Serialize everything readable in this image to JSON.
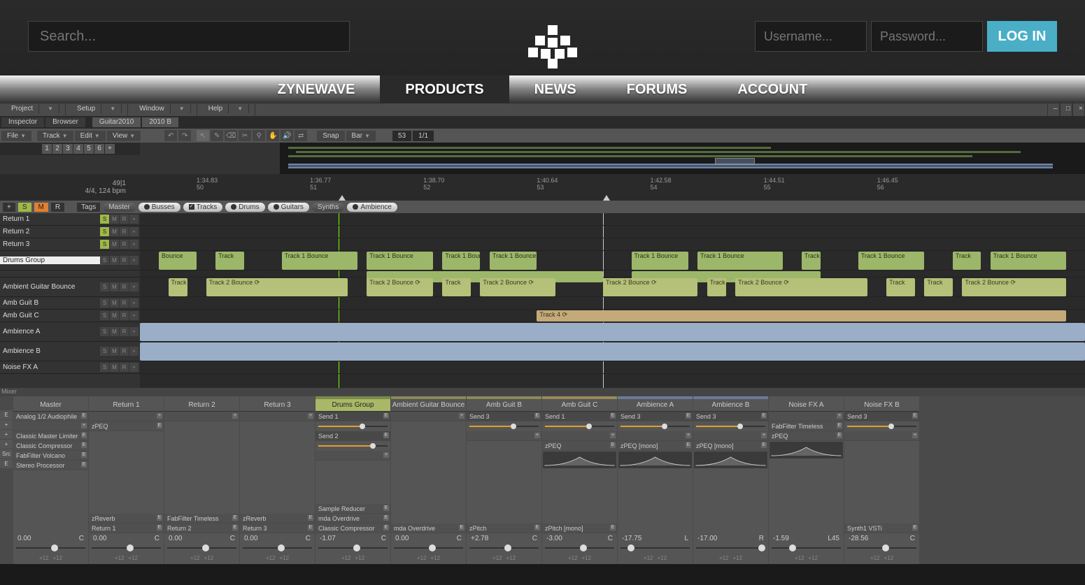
{
  "header": {
    "search_placeholder": "Search...",
    "username_placeholder": "Username...",
    "password_placeholder": "Password...",
    "login": "LOG IN"
  },
  "nav": [
    "ZYNEWAVE",
    "PRODUCTS",
    "NEWS",
    "FORUMS",
    "ACCOUNT"
  ],
  "nav_active": 1,
  "daw": {
    "menus": [
      "Project",
      "Setup",
      "Window",
      "Help"
    ],
    "tabs": [
      "Inspector",
      "Browser",
      "Guitar2010",
      "2010 B"
    ],
    "toolbar": {
      "file": "File",
      "track": "Track",
      "edit": "Edit",
      "view": "View",
      "snap": "Snap",
      "bar": "Bar",
      "pos": "53",
      "sig": "1/1"
    },
    "pages": [
      "1",
      "2",
      "3",
      "4",
      "5",
      "6",
      "+"
    ],
    "ruler": {
      "info_line1": "49|1",
      "info_line2": "4/4, 124 bpm",
      "ticks": [
        {
          "t": "1:34.83",
          "n": "50",
          "x": 6
        },
        {
          "t": "1:36.77",
          "n": "51",
          "x": 18
        },
        {
          "t": "1:38.70",
          "n": "52",
          "x": 30
        },
        {
          "t": "1:40.64",
          "n": "53",
          "x": 42
        },
        {
          "t": "1:42.58",
          "n": "54",
          "x": 54
        },
        {
          "t": "1:44.51",
          "n": "55",
          "x": 66
        },
        {
          "t": "1:46.45",
          "n": "56",
          "x": 78
        }
      ]
    },
    "filters": {
      "tags": "Tags",
      "master": "Master",
      "pills": [
        {
          "label": "Busses",
          "kind": "dot",
          "dark": false
        },
        {
          "label": "Tracks",
          "kind": "chk",
          "dark": false
        },
        {
          "label": "Drums",
          "kind": "dot",
          "dark": false
        },
        {
          "label": "Guitars",
          "kind": "dot",
          "dark": false
        },
        {
          "label": "Synths",
          "kind": "none",
          "dark": true
        },
        {
          "label": "Ambience",
          "kind": "dot",
          "dark": false
        }
      ]
    },
    "tracks": [
      {
        "name": "Return 1",
        "solo": true,
        "grp": false,
        "sel": false,
        "color": "d"
      },
      {
        "name": "Return 2",
        "solo": true,
        "grp": false,
        "sel": false,
        "color": "d"
      },
      {
        "name": "Return 3",
        "solo": true,
        "grp": false,
        "sel": false,
        "color": "d"
      },
      {
        "name": "Drums Group",
        "solo": false,
        "grp": true,
        "sel": true,
        "color": "g"
      },
      {
        "name": "",
        "solo": false,
        "grp": false,
        "sel": false,
        "color": "g",
        "sub": true
      },
      {
        "name": "Ambient Guitar Bounce",
        "solo": false,
        "grp": true,
        "sel": false,
        "color": "o"
      },
      {
        "name": "Amb Guit B",
        "solo": false,
        "grp": false,
        "sel": false,
        "color": "o"
      },
      {
        "name": "Amb Guit C",
        "solo": false,
        "grp": false,
        "sel": false,
        "color": "t"
      },
      {
        "name": "Ambience A",
        "solo": false,
        "grp": true,
        "sel": false,
        "color": "b"
      },
      {
        "name": "Ambience B",
        "solo": false,
        "grp": true,
        "sel": false,
        "color": "b"
      },
      {
        "name": "Noise FX A",
        "solo": false,
        "grp": false,
        "sel": false,
        "color": "d"
      }
    ],
    "clip_labels": {
      "t1b": "Track 1 Bounce",
      "t1": "Track",
      "t2b": "Track 2 Bounce ⟳",
      "t2": "Track",
      "t4": "Track 4 ⟳",
      "bounce": "Bounce"
    },
    "mixer_label": "Mixer",
    "channels": [
      {
        "name": "Master",
        "color": "d",
        "inserts": [
          "Analog 1/2 Audiophile",
          "",
          "Classic Master Limiter",
          "Classic Compressor",
          "FabFilter Volcano",
          "Stereo Processor"
        ],
        "val": "0.00",
        "pan": "C",
        "panpos": 50,
        "sends": []
      },
      {
        "name": "Return 1",
        "color": "d",
        "inserts": [
          "",
          "zPEQ"
        ],
        "fx": [
          "zReverb",
          "Return 1"
        ],
        "val": "0.00",
        "pan": "C",
        "panpos": 50,
        "sends": []
      },
      {
        "name": "Return 2",
        "color": "d",
        "inserts": [
          ""
        ],
        "fx": [
          "FabFilter Timeless",
          "Return 2"
        ],
        "val": "0.00",
        "pan": "C",
        "panpos": 50,
        "sends": []
      },
      {
        "name": "Return 3",
        "color": "d",
        "inserts": [
          ""
        ],
        "fx": [
          "zReverb",
          "Return 3"
        ],
        "val": "0.00",
        "pan": "C",
        "panpos": 50,
        "sends": []
      },
      {
        "name": "Drums Group",
        "color": "g",
        "sel": true,
        "sends": [
          "Send 1",
          "Send 2"
        ],
        "inserts": [
          ""
        ],
        "fx": [
          "Sample Reducer",
          "mda Overdrive",
          "Classic Compressor"
        ],
        "val": "-1.07",
        "pan": "C",
        "panpos": 50
      },
      {
        "name": "Ambient Guitar Bounce",
        "color": "o",
        "inserts": [
          ""
        ],
        "fx": [
          "mda Overdrive"
        ],
        "val": "0.00",
        "pan": "C",
        "panpos": 50,
        "sends": []
      },
      {
        "name": "Amb Guit B",
        "color": "o",
        "sends": [
          "Send 3"
        ],
        "inserts": [
          ""
        ],
        "fx": [
          "zPitch"
        ],
        "val": "+2.78",
        "pan": "C",
        "panpos": 50
      },
      {
        "name": "Amb Guit C",
        "color": "t",
        "sends": [
          "Send 1"
        ],
        "inserts": [
          "",
          "zPEQ"
        ],
        "fx": [
          "zPitch [mono]"
        ],
        "curve": true,
        "val": "-3.00",
        "pan": "C",
        "panpos": 50
      },
      {
        "name": "Ambience A",
        "color": "b",
        "sends": [
          "Send 3"
        ],
        "inserts": [
          "",
          "zPEQ [mono]"
        ],
        "curve": true,
        "val": "-17.75",
        "pan": "L",
        "panpos": 10
      },
      {
        "name": "Ambience B",
        "color": "b",
        "sends": [
          "Send 3"
        ],
        "inserts": [
          "",
          "zPEQ [mono]"
        ],
        "curve": true,
        "val": "-17.00",
        "pan": "R",
        "panpos": 90
      },
      {
        "name": "Noise FX A",
        "color": "d",
        "inserts": [
          "",
          "FabFilter Timeless",
          "zPEQ"
        ],
        "curve": true,
        "val": "-1.59",
        "pan": "L45",
        "panpos": 25,
        "sends": []
      },
      {
        "name": "Noise FX B",
        "color": "d",
        "sends": [
          "Send 3"
        ],
        "inserts": [
          ""
        ],
        "fx": [
          "Synth1 VSTi"
        ],
        "val": "-28.56",
        "pan": "C",
        "panpos": 50
      }
    ],
    "sidebtns": [
      "E",
      "+",
      "+",
      "+",
      "Src",
      "E"
    ],
    "meter": "+12"
  }
}
